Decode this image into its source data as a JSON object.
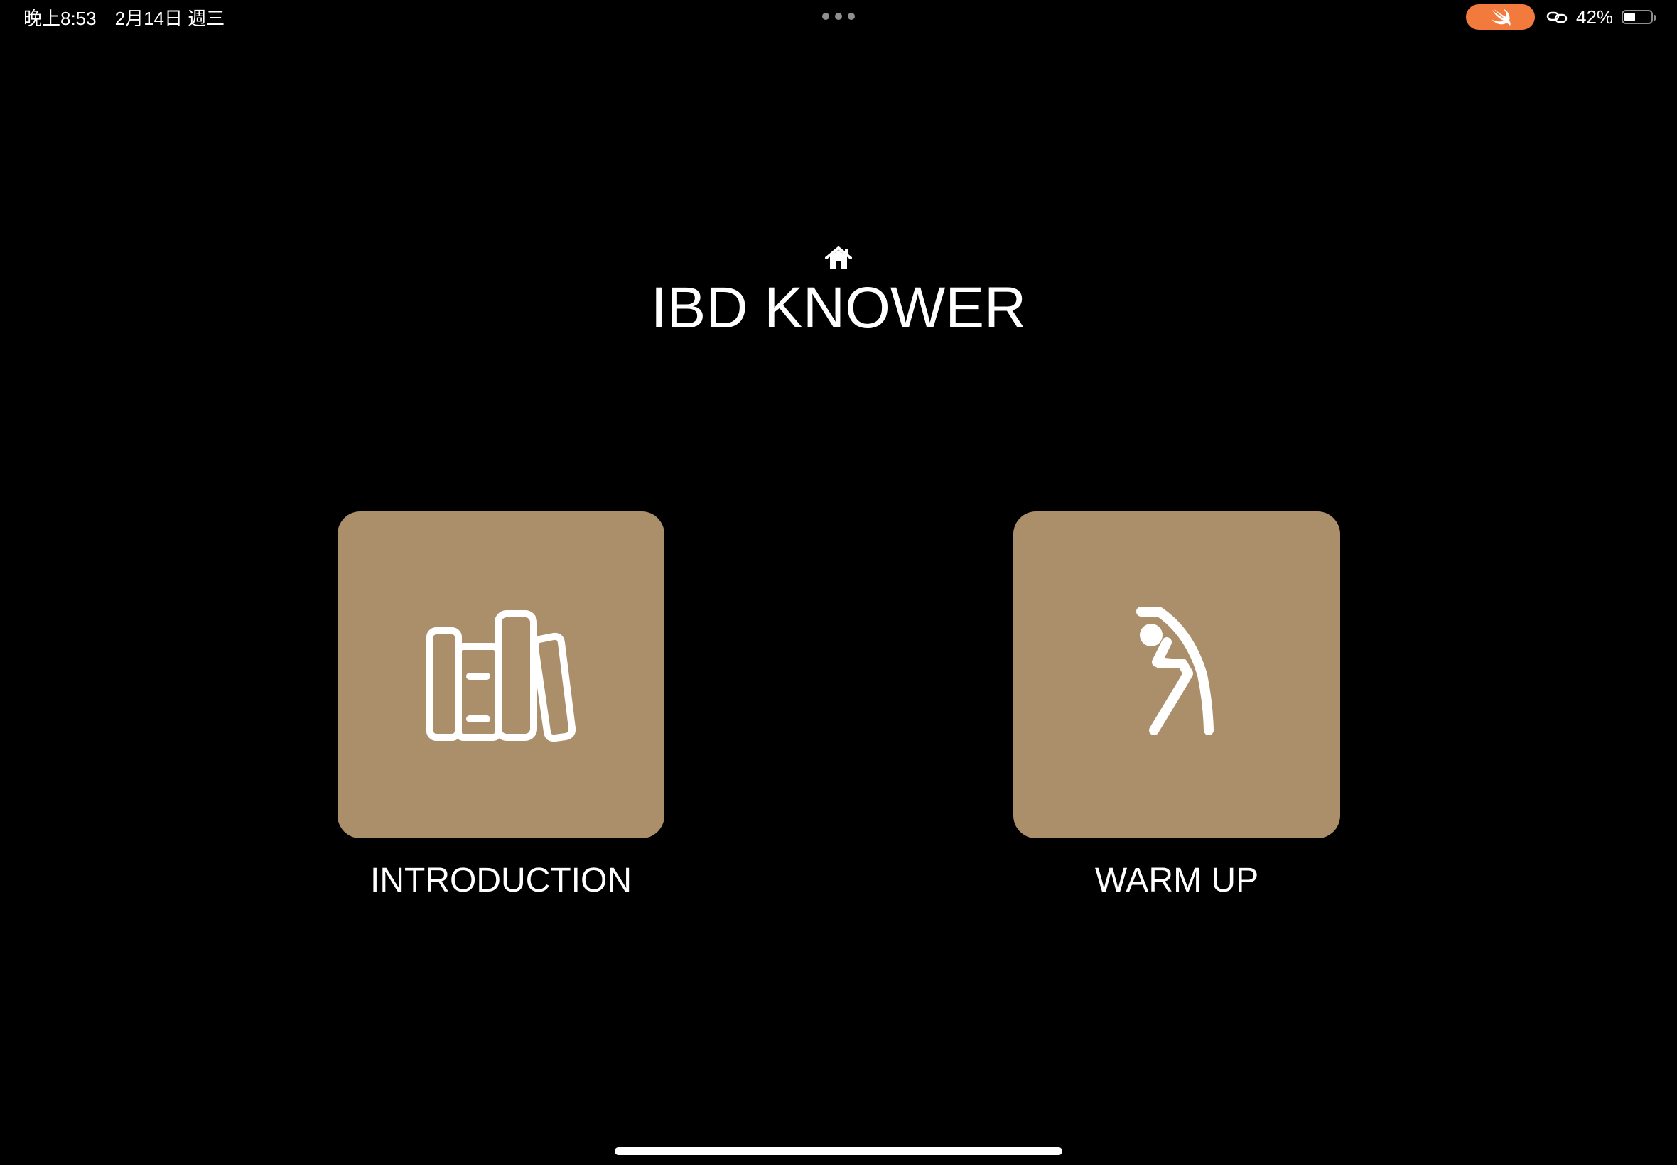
{
  "status_bar": {
    "time": "晚上8:53",
    "date": "2月14日 週三",
    "battery_percent": "42%",
    "battery_level": 0.42,
    "swift_pill_color": "#f27a3d",
    "icons": [
      "swift-bird-icon",
      "link-icon",
      "battery-icon"
    ]
  },
  "header": {
    "icon": "house-icon",
    "title": "IBD KNOWER"
  },
  "tiles": [
    {
      "label": "INTRODUCTION",
      "icon": "books-icon"
    },
    {
      "label": "WARM UP",
      "icon": "stretching-figure-icon"
    }
  ],
  "colors": {
    "background": "#000000",
    "tile": "#ab8f6b",
    "text": "#ffffff"
  }
}
